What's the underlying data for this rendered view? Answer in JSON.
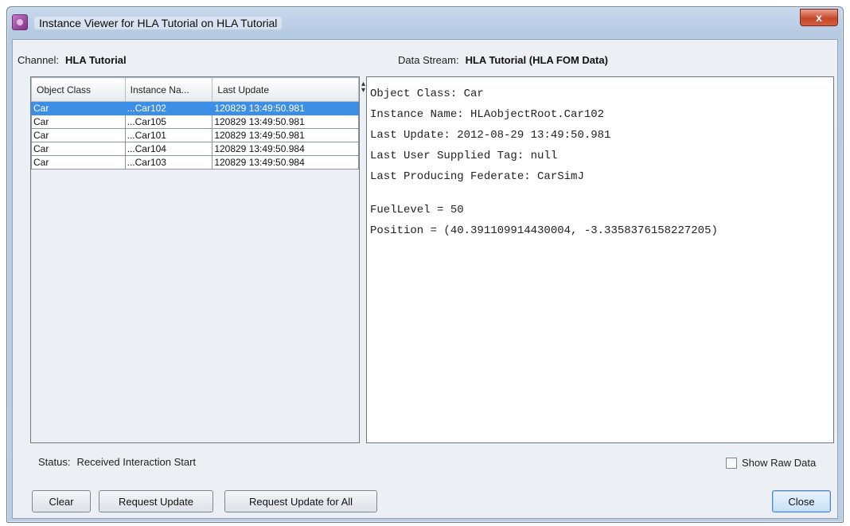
{
  "window": {
    "title": "Instance Viewer for HLA Tutorial on HLA Tutorial",
    "close_glyph": "x"
  },
  "header": {
    "channel_label": "Channel:",
    "channel_value": "HLA Tutorial",
    "stream_label": "Data Stream:",
    "stream_value": "HLA Tutorial (HLA FOM Data)"
  },
  "table": {
    "columns": [
      "Object Class",
      "Instance Na...",
      "Last Update"
    ],
    "rows": [
      {
        "object_class": "Car",
        "instance": "...Car102",
        "last_update": "120829 13:49:50.981",
        "selected": true
      },
      {
        "object_class": "Car",
        "instance": "...Car105",
        "last_update": "120829 13:49:50.981",
        "selected": false
      },
      {
        "object_class": "Car",
        "instance": "...Car101",
        "last_update": "120829 13:49:50.981",
        "selected": false
      },
      {
        "object_class": "Car",
        "instance": "...Car104",
        "last_update": "120829 13:49:50.984",
        "selected": false
      },
      {
        "object_class": "Car",
        "instance": "...Car103",
        "last_update": "120829 13:49:50.984",
        "selected": false
      }
    ]
  },
  "detail": {
    "lines": [
      "Object Class: Car",
      "Instance Name: HLAobjectRoot.Car102",
      "Last Update: 2012-08-29 13:49:50.981",
      "Last User Supplied Tag: null",
      "Last Producing Federate: CarSimJ"
    ],
    "attributes": [
      "FuelLevel = 50",
      "Position = (40.391109914430004, -3.3358376158227205)"
    ]
  },
  "status": {
    "label": "Status:",
    "text": "Received Interaction Start"
  },
  "options": {
    "show_raw_label": "Show Raw Data",
    "show_raw_checked": false
  },
  "buttons": {
    "clear": "Clear",
    "request_update": "Request Update",
    "request_update_all": "Request Update for All",
    "close": "Close"
  },
  "colors": {
    "selection": "#3d8ee6",
    "close_button": "#c7472c"
  }
}
